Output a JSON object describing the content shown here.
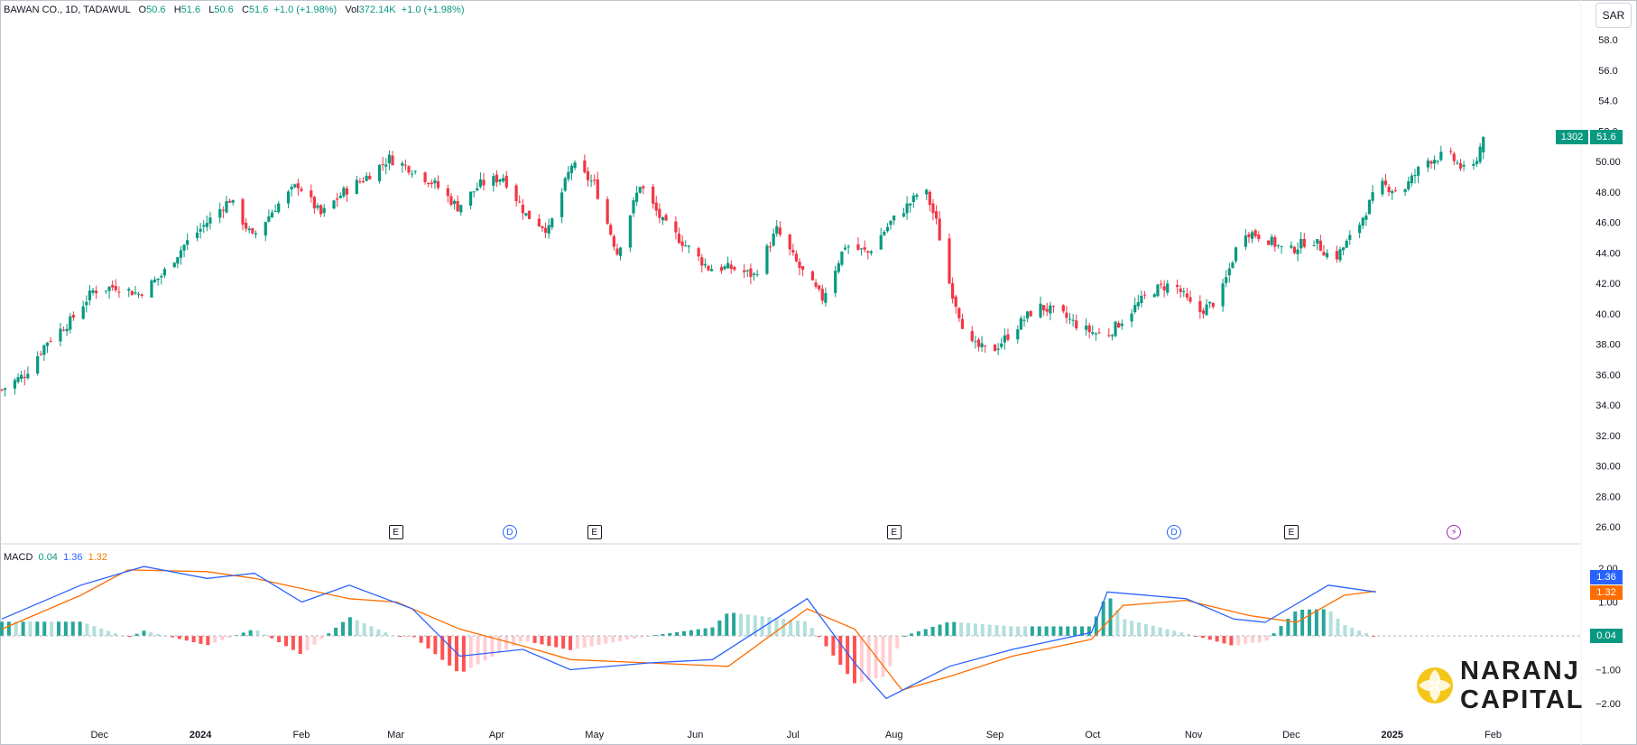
{
  "header": {
    "symbol": "BAWAN CO., 1D, TADAWUL",
    "o_label": "O",
    "o_value": "50.6",
    "h_label": "H",
    "h_value": "51.6",
    "l_label": "L",
    "l_value": "50.6",
    "c_label": "C",
    "c_value": "51.6",
    "change": "+1.0 (+1.98%)",
    "vol_label": "Vol",
    "vol_value": "372.14K",
    "vol_change": "+1.0 (+1.98%)"
  },
  "currency_button": "SAR",
  "price_tags": {
    "countdown": "1302",
    "last": "51.6"
  },
  "macd_legend": {
    "name": "MACD",
    "hist": "0.04",
    "macd": "1.36",
    "signal": "1.32"
  },
  "macd_tags": {
    "macd": "1.36",
    "signal": "1.32",
    "hist": "0.04"
  },
  "events": [
    {
      "type": "e",
      "label": "E",
      "month": "Mar"
    },
    {
      "type": "d",
      "label": "D",
      "month": "Apr"
    },
    {
      "type": "e",
      "label": "E",
      "month": "May"
    },
    {
      "type": "e",
      "label": "E",
      "month": "Aug"
    },
    {
      "type": "d",
      "label": "D",
      "month": "Oct"
    },
    {
      "type": "e",
      "label": "E",
      "month": "Nov"
    },
    {
      "type": "s",
      "label": "⚡",
      "month": "Dec"
    }
  ],
  "logo": {
    "line1": "NARANJ",
    "line2": "CAPITAL"
  },
  "colors": {
    "up": "#089981",
    "down": "#f23645",
    "macd": "#2962ff",
    "signal": "#ff6d00",
    "hist_up_strong": "#26a69a",
    "hist_up_weak": "#b2dfdb",
    "hist_dn_strong": "#ff5252",
    "hist_dn_weak": "#ffcdd2",
    "logo_gold": "#f5c518"
  },
  "chart_data": [
    {
      "type": "candlestick",
      "title": "BAWAN CO., 1D, TADAWUL",
      "currency": "SAR",
      "ylim": [
        26,
        58
      ],
      "y_ticks": [
        "58.0",
        "56.0",
        "54.0",
        "52.0",
        "50.00",
        "48.00",
        "46.00",
        "44.00",
        "42.00",
        "40.00",
        "38.00",
        "36.00",
        "34.00",
        "32.00",
        "30.00",
        "28.00",
        "26.00"
      ],
      "x_ticks": [
        "Dec",
        "2024",
        "Feb",
        "Mar",
        "Apr",
        "May",
        "Jun",
        "Jul",
        "Aug",
        "Sep",
        "Oct",
        "Nov",
        "Dec",
        "2025",
        "Feb"
      ],
      "x_tick_dates": [
        "2023-12-01",
        "2024-01-01",
        "2024-02-01",
        "2024-03-01",
        "2024-04-01",
        "2024-05-01",
        "2024-06-01",
        "2024-07-01",
        "2024-08-01",
        "2024-09-01",
        "2024-10-01",
        "2024-11-01",
        "2024-12-01",
        "2025-01-01",
        "2025-02-01"
      ],
      "x_range": [
        "2023-11-01",
        "2025-02-28"
      ],
      "weekly_closes": [
        [
          "2023-11-01",
          35.0
        ],
        [
          "2023-11-08",
          36.0
        ],
        [
          "2023-11-15",
          38.2
        ],
        [
          "2023-11-22",
          39.5
        ],
        [
          "2023-11-29",
          41.5
        ],
        [
          "2023-12-06",
          41.8
        ],
        [
          "2023-12-13",
          41.3
        ],
        [
          "2023-12-20",
          42.5
        ],
        [
          "2023-12-27",
          44.5
        ],
        [
          "2024-01-03",
          46.0
        ],
        [
          "2024-01-10",
          47.5
        ],
        [
          "2024-01-17",
          45.0
        ],
        [
          "2024-01-24",
          47.0
        ],
        [
          "2024-01-31",
          48.5
        ],
        [
          "2024-02-07",
          46.5
        ],
        [
          "2024-02-14",
          48.0
        ],
        [
          "2024-02-21",
          49.0
        ],
        [
          "2024-02-28",
          50.2
        ],
        [
          "2024-03-06",
          49.5
        ],
        [
          "2024-03-13",
          48.5
        ],
        [
          "2024-03-20",
          47.0
        ],
        [
          "2024-03-27",
          48.5
        ],
        [
          "2024-04-03",
          49.0
        ],
        [
          "2024-04-10",
          46.5
        ],
        [
          "2024-04-17",
          45.5
        ],
        [
          "2024-04-24",
          49.8
        ],
        [
          "2024-05-01",
          48.5
        ],
        [
          "2024-05-08",
          44.0
        ],
        [
          "2024-05-15",
          48.5
        ],
        [
          "2024-05-22",
          46.0
        ],
        [
          "2024-05-29",
          44.5
        ],
        [
          "2024-06-05",
          43.0
        ],
        [
          "2024-06-12",
          43.0
        ],
        [
          "2024-06-19",
          42.5
        ],
        [
          "2024-06-26",
          45.5
        ],
        [
          "2024-07-03",
          43.0
        ],
        [
          "2024-07-10",
          41.0
        ],
        [
          "2024-07-17",
          44.5
        ],
        [
          "2024-07-24",
          44.0
        ],
        [
          "2024-07-31",
          46.0
        ],
        [
          "2024-08-07",
          47.5
        ],
        [
          "2024-08-10",
          48.5
        ],
        [
          "2024-08-14",
          46.0
        ],
        [
          "2024-08-18",
          42.0
        ],
        [
          "2024-08-24",
          38.0
        ],
        [
          "2024-08-31",
          37.5
        ],
        [
          "2024-09-07",
          39.0
        ],
        [
          "2024-09-14",
          40.5
        ],
        [
          "2024-09-21",
          40.0
        ],
        [
          "2024-09-28",
          39.0
        ],
        [
          "2024-10-05",
          38.5
        ],
        [
          "2024-10-12",
          40.0
        ],
        [
          "2024-10-19",
          41.5
        ],
        [
          "2024-10-26",
          42.0
        ],
        [
          "2024-11-02",
          40.0
        ],
        [
          "2024-11-09",
          41.0
        ],
        [
          "2024-11-16",
          45.5
        ],
        [
          "2024-11-23",
          45.0
        ],
        [
          "2024-11-30",
          44.0
        ],
        [
          "2024-12-07",
          45.0
        ],
        [
          "2024-12-14",
          43.5
        ],
        [
          "2024-12-21",
          45.5
        ],
        [
          "2024-12-28",
          48.5
        ],
        [
          "2025-01-04",
          48.0
        ],
        [
          "2025-01-11",
          50.0
        ],
        [
          "2025-01-18",
          50.5
        ],
        [
          "2025-01-25",
          49.0
        ],
        [
          "2025-01-29",
          51.6
        ]
      ],
      "last": {
        "open": 50.6,
        "high": 51.6,
        "low": 50.6,
        "close": 51.6,
        "volume": "372.14K"
      }
    },
    {
      "type": "line",
      "title": "MACD",
      "ylim": [
        -2.0,
        2.0
      ],
      "y_ticks": [
        "2.00",
        "1.00",
        "−1.00",
        "−2.00"
      ],
      "series": [
        {
          "name": "MACD",
          "points": [
            [
              0,
              0.5
            ],
            [
              0.05,
              1.5
            ],
            [
              0.09,
              2.05
            ],
            [
              0.13,
              1.7
            ],
            [
              0.16,
              1.85
            ],
            [
              0.19,
              1.0
            ],
            [
              0.22,
              1.5
            ],
            [
              0.26,
              0.8
            ],
            [
              0.29,
              -0.6
            ],
            [
              0.33,
              -0.4
            ],
            [
              0.36,
              -1.0
            ],
            [
              0.41,
              -0.8
            ],
            [
              0.45,
              -0.7
            ],
            [
              0.51,
              1.1
            ],
            [
              0.54,
              -0.8
            ],
            [
              0.56,
              -1.85
            ],
            [
              0.6,
              -0.9
            ],
            [
              0.64,
              -0.4
            ],
            [
              0.69,
              0.1
            ],
            [
              0.7,
              1.3
            ],
            [
              0.75,
              1.1
            ],
            [
              0.78,
              0.5
            ],
            [
              0.8,
              0.4
            ],
            [
              0.84,
              1.5
            ],
            [
              0.87,
              1.3
            ]
          ]
        },
        {
          "name": "Signal",
          "points": [
            [
              0,
              0.2
            ],
            [
              0.05,
              1.2
            ],
            [
              0.08,
              1.95
            ],
            [
              0.13,
              1.9
            ],
            [
              0.16,
              1.7
            ],
            [
              0.22,
              1.1
            ],
            [
              0.25,
              1.0
            ],
            [
              0.29,
              0.2
            ],
            [
              0.33,
              -0.3
            ],
            [
              0.36,
              -0.7
            ],
            [
              0.41,
              -0.8
            ],
            [
              0.46,
              -0.9
            ],
            [
              0.51,
              0.8
            ],
            [
              0.54,
              0.2
            ],
            [
              0.57,
              -1.6
            ],
            [
              0.6,
              -1.2
            ],
            [
              0.64,
              -0.6
            ],
            [
              0.69,
              -0.1
            ],
            [
              0.71,
              0.9
            ],
            [
              0.75,
              1.05
            ],
            [
              0.79,
              0.6
            ],
            [
              0.82,
              0.4
            ],
            [
              0.85,
              1.2
            ],
            [
              0.87,
              1.32
            ]
          ]
        }
      ],
      "histogram_note": "MACD minus Signal",
      "last_values": {
        "macd": 1.36,
        "signal": 1.32,
        "hist": 0.04
      }
    }
  ]
}
